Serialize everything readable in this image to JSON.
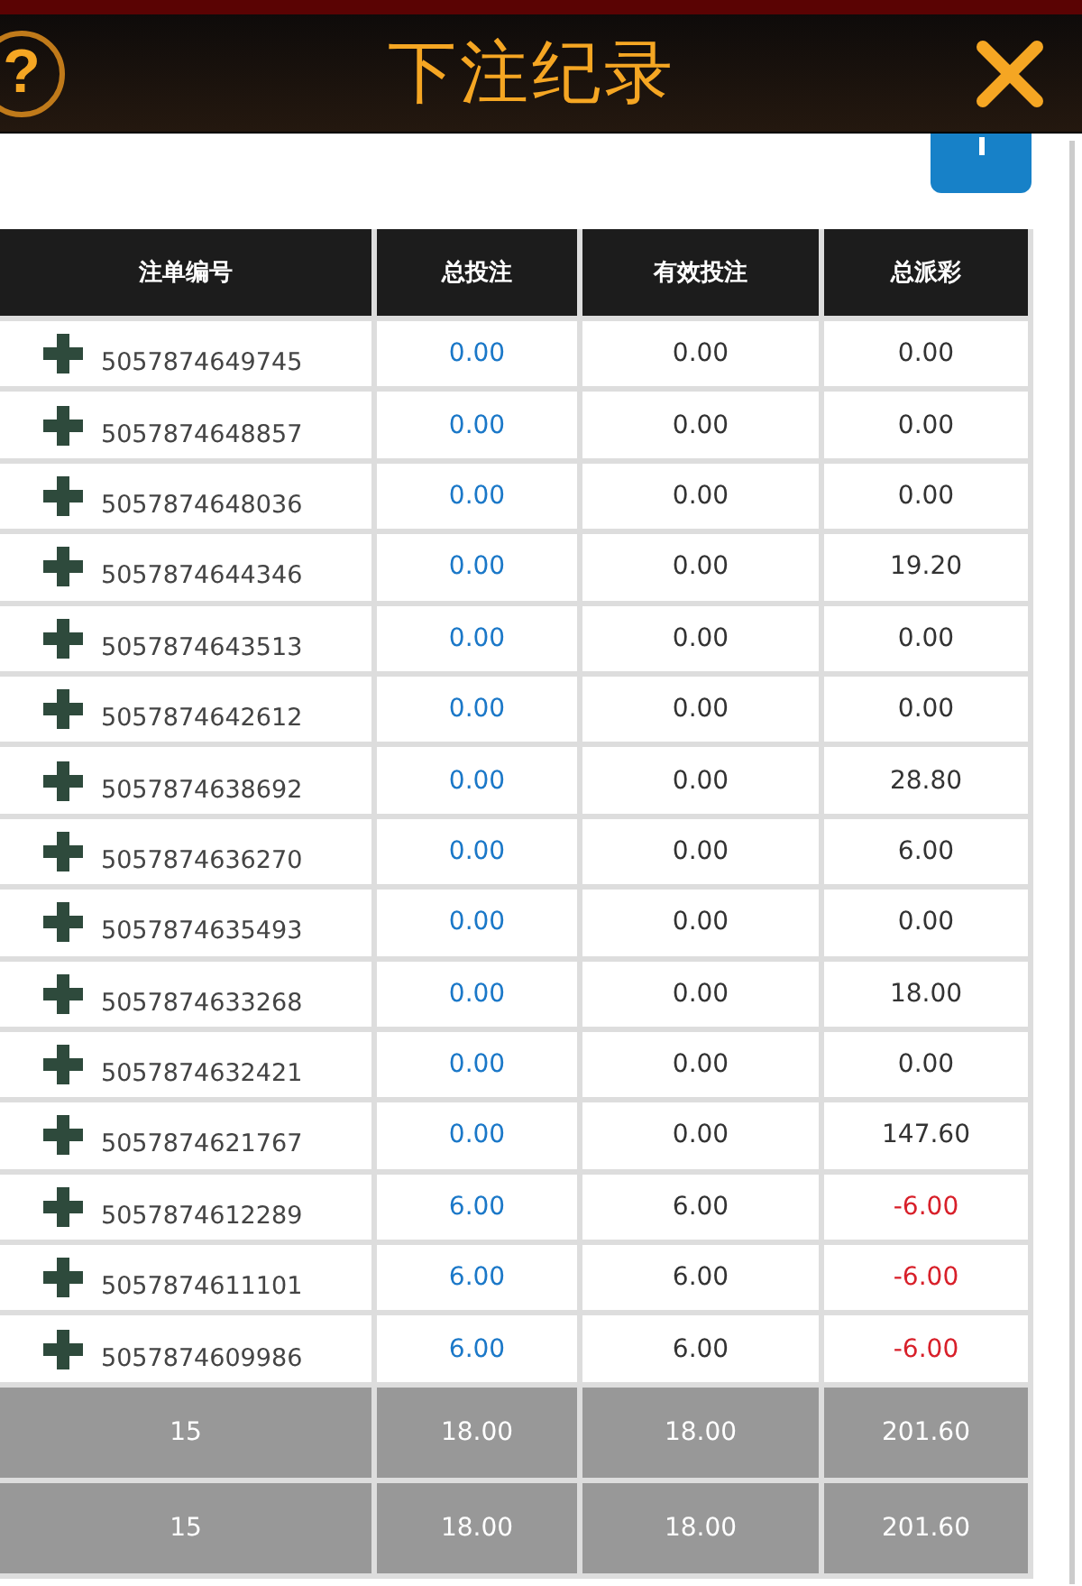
{
  "header": {
    "help": "?",
    "title": "下注纪录"
  },
  "table": {
    "columns": [
      "注单编号",
      "总投注",
      "有效投注",
      "总派彩"
    ],
    "rows": [
      {
        "id": "5057874649745",
        "total": "0.00",
        "valid": "0.00",
        "payout": "0.00",
        "loss": false
      },
      {
        "id": "5057874648857",
        "total": "0.00",
        "valid": "0.00",
        "payout": "0.00",
        "loss": false
      },
      {
        "id": "5057874648036",
        "total": "0.00",
        "valid": "0.00",
        "payout": "0.00",
        "loss": false
      },
      {
        "id": "5057874644346",
        "total": "0.00",
        "valid": "0.00",
        "payout": "19.20",
        "loss": false
      },
      {
        "id": "5057874643513",
        "total": "0.00",
        "valid": "0.00",
        "payout": "0.00",
        "loss": false
      },
      {
        "id": "5057874642612",
        "total": "0.00",
        "valid": "0.00",
        "payout": "0.00",
        "loss": false
      },
      {
        "id": "5057874638692",
        "total": "0.00",
        "valid": "0.00",
        "payout": "28.80",
        "loss": false
      },
      {
        "id": "5057874636270",
        "total": "0.00",
        "valid": "0.00",
        "payout": "6.00",
        "loss": false
      },
      {
        "id": "5057874635493",
        "total": "0.00",
        "valid": "0.00",
        "payout": "0.00",
        "loss": false
      },
      {
        "id": "5057874633268",
        "total": "0.00",
        "valid": "0.00",
        "payout": "18.00",
        "loss": false
      },
      {
        "id": "5057874632421",
        "total": "0.00",
        "valid": "0.00",
        "payout": "0.00",
        "loss": false
      },
      {
        "id": "5057874621767",
        "total": "0.00",
        "valid": "0.00",
        "payout": "147.60",
        "loss": false
      },
      {
        "id": "5057874612289",
        "total": "6.00",
        "valid": "6.00",
        "payout": "-6.00",
        "loss": true
      },
      {
        "id": "5057874611101",
        "total": "6.00",
        "valid": "6.00",
        "payout": "-6.00",
        "loss": true
      },
      {
        "id": "5057874609986",
        "total": "6.00",
        "valid": "6.00",
        "payout": "-6.00",
        "loss": true
      }
    ],
    "totals": [
      [
        "15",
        "18.00",
        "18.00",
        "201.60"
      ],
      [
        "15",
        "18.00",
        "18.00",
        "201.60"
      ]
    ]
  }
}
